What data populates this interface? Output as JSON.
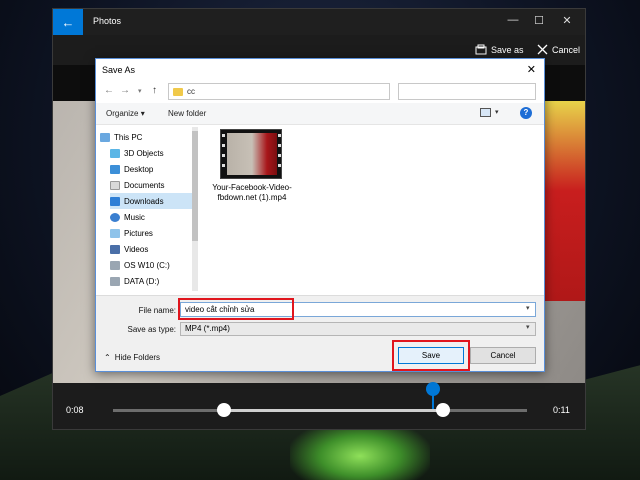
{
  "app": {
    "title": "Photos",
    "back_glyph": "←",
    "controls": {
      "minimize": "—",
      "maximize": "☐",
      "close": "✕"
    }
  },
  "toolbar": {
    "save_as_label": "Save as",
    "cancel_label": "Cancel"
  },
  "timeline": {
    "start_time": "0:08",
    "end_time": "0:11",
    "accent_color": "#0078d7"
  },
  "dialog": {
    "title": "Save As",
    "address": "cc",
    "search_placeholder": "",
    "commands": {
      "organize": "Organize",
      "new_folder": "New folder"
    },
    "nav_items": [
      {
        "label": "This PC",
        "icon": "computer-icon"
      },
      {
        "label": "3D Objects",
        "icon": "cube-icon"
      },
      {
        "label": "Desktop",
        "icon": "desktop-icon"
      },
      {
        "label": "Documents",
        "icon": "documents-icon"
      },
      {
        "label": "Downloads",
        "icon": "download-icon",
        "selected": true
      },
      {
        "label": "Music",
        "icon": "music-icon"
      },
      {
        "label": "Pictures",
        "icon": "pictures-icon"
      },
      {
        "label": "Videos",
        "icon": "videos-icon"
      },
      {
        "label": "OS W10 (C:)",
        "icon": "drive-icon"
      },
      {
        "label": "DATA (D:)",
        "icon": "drive-icon"
      }
    ],
    "file": {
      "name": "Your-Facebook-Video-fbdown.net (1).mp4"
    },
    "file_name_label": "File name:",
    "file_name_value": "video cắt chỉnh sửa",
    "save_type_label": "Save as type:",
    "save_type_value": "MP4 (*.mp4)",
    "hide_folders_label": "Hide Folders",
    "save_button": "Save",
    "cancel_button": "Cancel",
    "highlight_color": "#e0151d"
  }
}
